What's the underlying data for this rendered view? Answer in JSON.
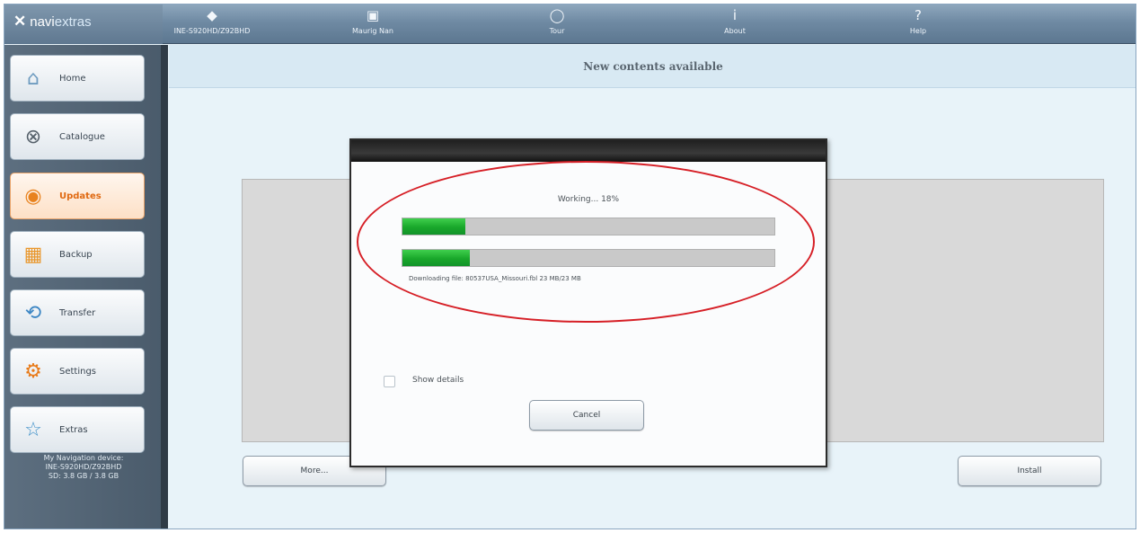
{
  "app": {
    "logo": {
      "brand_main": "navi",
      "brand_sub": "extras"
    },
    "topnav": [
      {
        "icon": "device-icon",
        "glyph": "◆",
        "label": "INE-S920HD/Z92BHD"
      },
      {
        "icon": "shop-icon",
        "glyph": "▣",
        "label": "Maurig Nan"
      },
      {
        "icon": "tour-icon",
        "glyph": "◯",
        "label": "Tour"
      },
      {
        "icon": "info-icon",
        "glyph": "i",
        "label": "About"
      },
      {
        "icon": "help-icon",
        "glyph": "?",
        "label": "Help"
      }
    ]
  },
  "sidebar": {
    "items": [
      {
        "label": "Home",
        "icon": "home-icon",
        "glyph": "⌂"
      },
      {
        "label": "Catalogue",
        "icon": "catalogue-icon",
        "glyph": "⊗"
      },
      {
        "label": "Updates",
        "icon": "updates-icon",
        "glyph": "◉",
        "active": true
      },
      {
        "label": "Backup",
        "icon": "backup-icon",
        "glyph": "▦"
      },
      {
        "label": "Transfer",
        "icon": "transfer-icon",
        "glyph": "⟲"
      },
      {
        "label": "Settings",
        "icon": "settings-icon",
        "glyph": "⚙"
      },
      {
        "label": "Extras",
        "icon": "star-icon",
        "glyph": "☆"
      }
    ],
    "device_info": [
      "My Navigation device:",
      "INE-S920HD/Z92BHD",
      "SD: 3.8 GB / 3.8 GB"
    ]
  },
  "main": {
    "header": "New contents available",
    "more_button": "More...",
    "install_button": "Install"
  },
  "dialog": {
    "working_text": "Working... 18%",
    "progress_overall": 0.17,
    "progress_file": 0.18,
    "downloading_text": "Downloading file: 80537USA_Missouri.fbl 23 MB/23 MB",
    "show_details_label": "Show details",
    "cancel_button": "Cancel"
  },
  "colors": {
    "progress_green": "#19a72a",
    "annotation_red": "#d61f26",
    "active_orange": "#e06a12"
  }
}
